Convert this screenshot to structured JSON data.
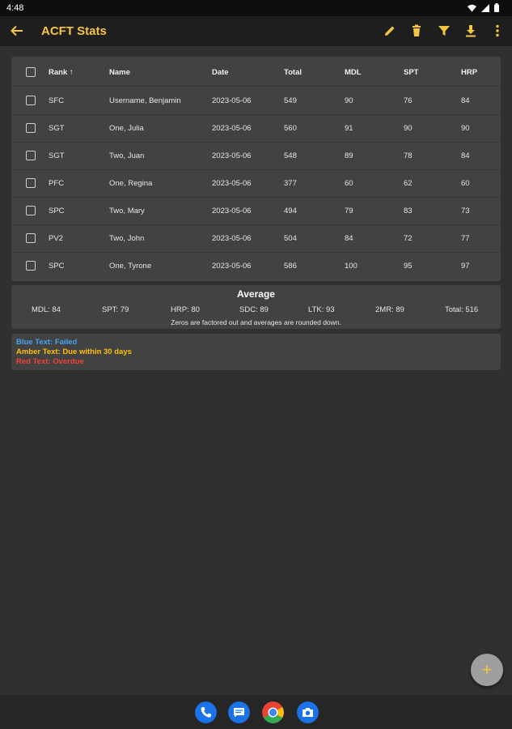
{
  "status_bar": {
    "time": "4:48"
  },
  "app_bar": {
    "title": "ACFT Stats"
  },
  "table": {
    "columns": [
      {
        "key": "rank",
        "label": "Rank"
      },
      {
        "key": "name",
        "label": "Name"
      },
      {
        "key": "date",
        "label": "Date"
      },
      {
        "key": "total",
        "label": "Total"
      },
      {
        "key": "mdl",
        "label": "MDL"
      },
      {
        "key": "spt",
        "label": "SPT"
      },
      {
        "key": "hrp",
        "label": "HRP"
      }
    ],
    "sort_indicator": "↑",
    "rows": [
      {
        "rank": "SFC",
        "name": "Username, Benjamin",
        "date": "2023-05-06",
        "total": "549",
        "mdl": "90",
        "spt": "76",
        "hrp": "84"
      },
      {
        "rank": "SGT",
        "name": "One, Julia",
        "date": "2023-05-06",
        "total": "560",
        "mdl": "91",
        "spt": "90",
        "hrp": "90"
      },
      {
        "rank": "SGT",
        "name": "Two, Juan",
        "date": "2023-05-06",
        "total": "548",
        "mdl": "89",
        "spt": "78",
        "hrp": "84"
      },
      {
        "rank": "PFC",
        "name": "One, Regina",
        "date": "2023-05-06",
        "total": "377",
        "mdl": "60",
        "spt": "62",
        "hrp": "60"
      },
      {
        "rank": "SPC",
        "name": "Two, Mary",
        "date": "2023-05-06",
        "total": "494",
        "mdl": "79",
        "spt": "83",
        "hrp": "73"
      },
      {
        "rank": "PV2",
        "name": "Two, John",
        "date": "2023-05-06",
        "total": "504",
        "mdl": "84",
        "spt": "72",
        "hrp": "77"
      },
      {
        "rank": "SPC",
        "name": "One, Tyrone",
        "date": "2023-05-06",
        "total": "586",
        "mdl": "100",
        "spt": "95",
        "hrp": "97"
      }
    ]
  },
  "average": {
    "title": "Average",
    "stats": [
      "MDL: 84",
      "SPT: 79",
      "HRP: 80",
      "SDC: 89",
      "LTK: 93",
      "2MR: 89",
      "Total: 516"
    ],
    "note": "Zeros are factored out and averages are rounded down."
  },
  "legend": [
    {
      "text": "Blue Text: Failed",
      "color": "#42a5f5"
    },
    {
      "text": "Amber Text: Due within 30 days",
      "color": "#ffc107"
    },
    {
      "text": "Red Text: Overdue",
      "color": "#f44336"
    }
  ],
  "fab": {
    "label": "+"
  },
  "colors": {
    "accent": "#f5c542",
    "background": "#303030",
    "card": "#424242",
    "app_bar": "#1e1e1e"
  },
  "icons": {
    "app_bar": [
      "back-arrow-icon",
      "edit-pencil-icon",
      "delete-trash-icon",
      "filter-icon",
      "download-icon",
      "more-vert-icon"
    ],
    "dock": [
      "phone-icon",
      "messages-icon",
      "chrome-icon",
      "camera-icon"
    ]
  }
}
